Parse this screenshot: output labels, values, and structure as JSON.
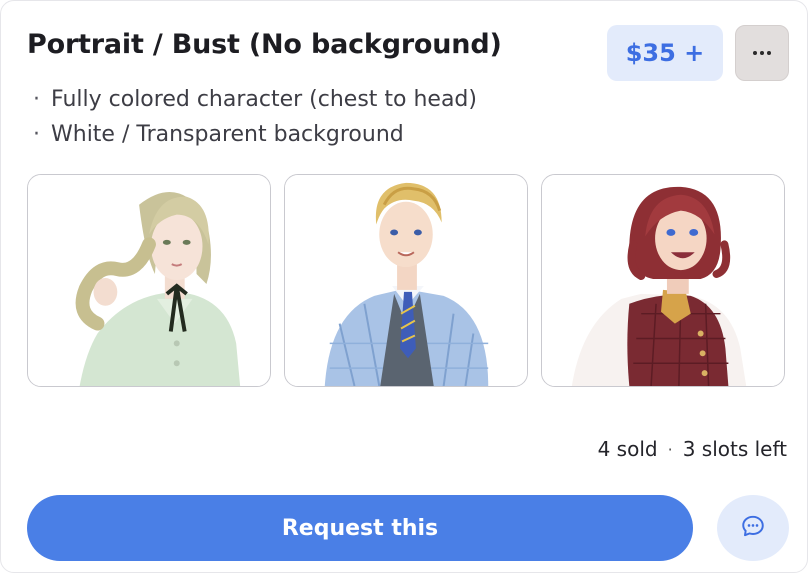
{
  "listing": {
    "title": "Portrait / Bust (No background)",
    "price": "$35 +",
    "features": [
      {
        "bullet": "·",
        "text": "Fully colored character (chest to head)"
      },
      {
        "bullet": "·",
        "text": "White / Transparent background"
      }
    ],
    "stats": {
      "sold": "4 sold",
      "separator": "·",
      "slots": "3 slots left"
    },
    "request_label": "Request this",
    "icons": {
      "more": "ellipsis-icon",
      "chat": "chat-bubble-icon"
    },
    "colors": {
      "accent": "#4a7fe6",
      "price_text": "#3d6ee2",
      "price_bg": "#e3ebfb",
      "more_bg": "#e2dedd"
    },
    "examples": [
      {
        "name": "example-image-1"
      },
      {
        "name": "example-image-2"
      },
      {
        "name": "example-image-3"
      }
    ]
  }
}
